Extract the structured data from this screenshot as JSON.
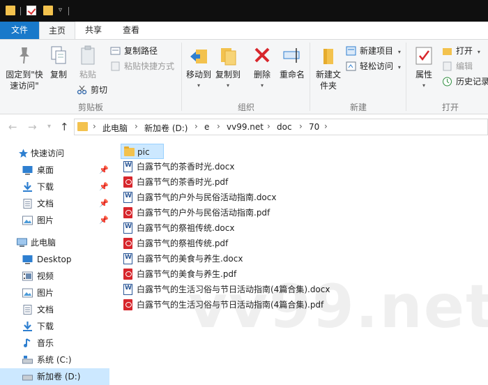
{
  "titlebar": {
    "icons": [
      "folder-icon",
      "properties-icon",
      "folder-icon",
      "customize-quick-access-icon"
    ]
  },
  "tabs": {
    "file": "文件",
    "home": "主页",
    "share": "共享",
    "view": "查看"
  },
  "ribbon": {
    "clipboard": {
      "group_label": "剪贴板",
      "pin_quick_access": "固定到\"快速访问\"",
      "copy": "复制",
      "paste": "粘贴",
      "copy_path": "复制路径",
      "paste_shortcut": "粘贴快捷方式",
      "cut": "剪切"
    },
    "organize": {
      "group_label": "组织",
      "move_to": "移动到",
      "copy_to": "复制到",
      "delete": "删除",
      "rename": "重命名"
    },
    "new": {
      "group_label": "新建",
      "new_folder": "新建文件夹",
      "new_item": "新建项目",
      "easy_access": "轻松访问"
    },
    "open": {
      "group_label": "打开",
      "properties": "属性",
      "open": "打开",
      "edit": "编辑",
      "history": "历史记录"
    }
  },
  "address": {
    "crumbs": [
      "此电脑",
      "新加卷 (D:)",
      "e",
      "vv99.net",
      "doc",
      "70"
    ]
  },
  "navpane": {
    "quick_access": "快速访问",
    "quick_items": [
      "桌面",
      "下载",
      "文档",
      "图片"
    ],
    "this_pc": "此电脑",
    "pc_items": [
      "Desktop",
      "视频",
      "图片",
      "文档",
      "下载",
      "音乐",
      "系统 (C:)",
      "新加卷 (D:)"
    ]
  },
  "files": [
    {
      "name": "pic",
      "type": "folder"
    },
    {
      "name": "白露节气的茶香时光.docx",
      "type": "docx"
    },
    {
      "name": "白露节气的茶香时光.pdf",
      "type": "pdf"
    },
    {
      "name": "白露节气的户外与民俗活动指南.docx",
      "type": "docx"
    },
    {
      "name": "白露节气的户外与民俗活动指南.pdf",
      "type": "pdf"
    },
    {
      "name": "白露节气的祭祖传统.docx",
      "type": "docx"
    },
    {
      "name": "白露节气的祭祖传统.pdf",
      "type": "pdf"
    },
    {
      "name": "白露节气的美食与养生.docx",
      "type": "docx"
    },
    {
      "name": "白露节气的美食与养生.pdf",
      "type": "pdf"
    },
    {
      "name": "白露节气的生活习俗与节日活动指南(4篇合集).docx",
      "type": "docx"
    },
    {
      "name": "白露节气的生活习俗与节日活动指南(4篇合集).pdf",
      "type": "pdf"
    }
  ],
  "watermark": "vv99.net",
  "colors": {
    "accent": "#1979ca",
    "selection": "#cce8ff",
    "folder": "#f3c24e",
    "pdf": "#d7262c",
    "word": "#2b5797"
  }
}
